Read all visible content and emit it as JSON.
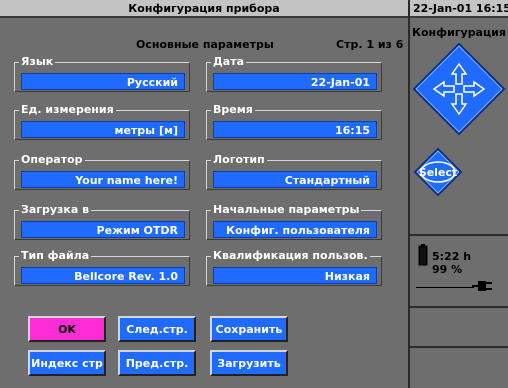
{
  "header": {
    "title": "Конфигурация прибора",
    "datetime": "22-Jan-01 16:15"
  },
  "main": {
    "section_title": "Основные параметры",
    "page_label": "Стр. 1 из 6",
    "fields": {
      "language": {
        "label": "Язык",
        "value": "Русский"
      },
      "date": {
        "label": "Дата",
        "value": "22-Jan-01"
      },
      "units": {
        "label": "Ед. измерения",
        "value": "метры [м]"
      },
      "time": {
        "label": "Время",
        "value": "16:15"
      },
      "operator": {
        "label": "Оператор",
        "value": "Your name here!"
      },
      "logo": {
        "label": "Логотип",
        "value": "Стандартный"
      },
      "boot": {
        "label": "Загрузка в",
        "value": "Режим OTDR"
      },
      "startup": {
        "label": "Начальные параметры",
        "value": "Конфиг. пользователя"
      },
      "filetype": {
        "label": "Тип файла",
        "value": "Bellcore Rev. 1.0"
      },
      "qualification": {
        "label": "Квалификация пользов.",
        "value": "Низкая"
      }
    }
  },
  "buttons": {
    "ok": "OK",
    "next": "След.стр.",
    "save": "Сохранить",
    "index": "Индекс стр",
    "prev": "Пред.стр.",
    "load": "Загрузить"
  },
  "side": {
    "title": "Конфигурация",
    "select_label": "Select",
    "battery_time": "5:22 h",
    "battery_percent": "99 %"
  },
  "colors": {
    "field_blue": "#1f6bff",
    "ok_pink": "#ff2bd4",
    "background": "#6e6e6e",
    "bar": "#c4c4c4"
  }
}
